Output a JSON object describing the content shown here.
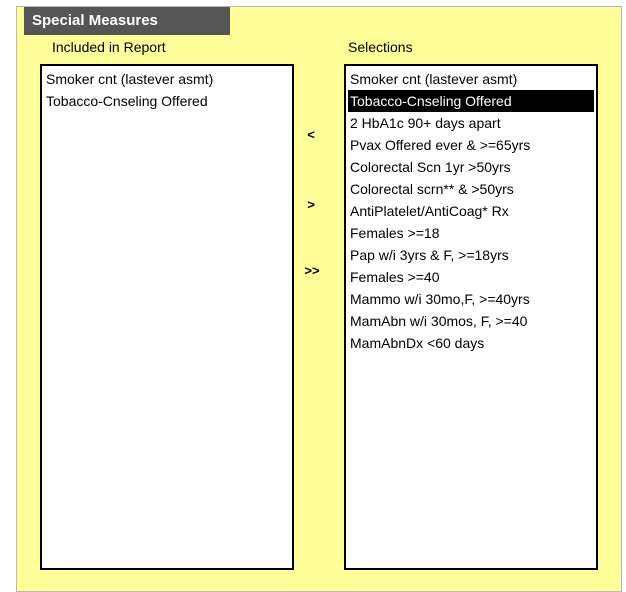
{
  "group": {
    "title": "Special Measures"
  },
  "included": {
    "label": "Included in Report",
    "items": [
      "Smoker cnt (lastever asmt)",
      "Tobacco-Cnseling Offered"
    ]
  },
  "selections": {
    "label": "Selections",
    "selected_index": 1,
    "items": [
      "Smoker cnt (lastever asmt)",
      "Tobacco-Cnseling Offered",
      "2 HbA1c 90+ days apart",
      "Pvax Offered ever & >=65yrs",
      "Colorectal Scn 1yr >50yrs",
      "Colorectal scrn** & >50yrs",
      "AntiPlatelet/AntiCoag* Rx",
      "Females >=18",
      "Pap w/i 3yrs & F, >=18yrs",
      "Females >=40",
      "Mammo w/i 30mo,F, >=40yrs",
      "MamAbn w/i 30mos, F, >=40",
      "MamAbnDx <60 days"
    ]
  },
  "buttons": {
    "remove_label": "<",
    "add_label": ">",
    "add_all_label": ">>"
  },
  "colors": {
    "panel_background": "#ffff99",
    "title_background": "#555555",
    "selected_background": "#000000"
  }
}
